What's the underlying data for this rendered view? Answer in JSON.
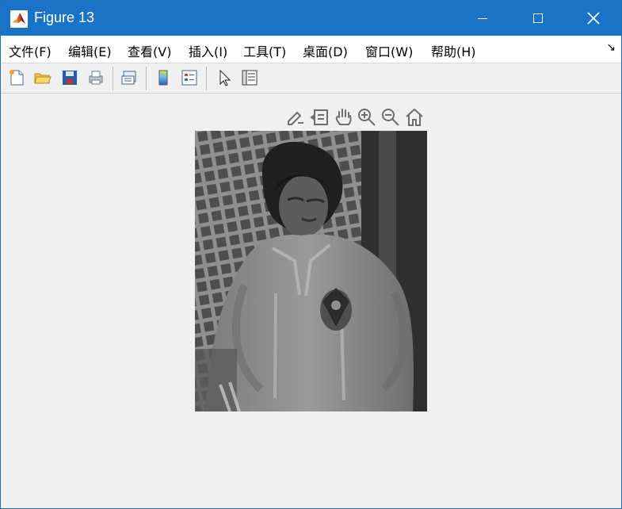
{
  "window": {
    "title": "Figure 13"
  },
  "menu": {
    "items": [
      "文件(F)",
      "编辑(E)",
      "查看(V)",
      "插入(I)",
      "工具(T)",
      "桌面(D)",
      "窗口(W)",
      "帮助(H)"
    ],
    "collapse_arrow": "↘"
  },
  "toolbar": {
    "icons": [
      "new-figure-icon",
      "open-file-icon",
      "save-icon",
      "print-icon",
      "link-plot-icon",
      "colorbar-icon",
      "legend-icon",
      "select-pointer-icon",
      "property-inspector-icon"
    ]
  },
  "axes_toolbar": {
    "icons": [
      "brush-icon",
      "data-tips-icon",
      "pan-icon",
      "zoom-in-icon",
      "zoom-out-icon",
      "home-icon"
    ]
  },
  "figure": {
    "image_description": "grayscale photo of a child in a jacket standing in front of a lattice fence"
  },
  "colors": {
    "titlebar": "#1b73c8",
    "background": "#f0f0f0"
  }
}
